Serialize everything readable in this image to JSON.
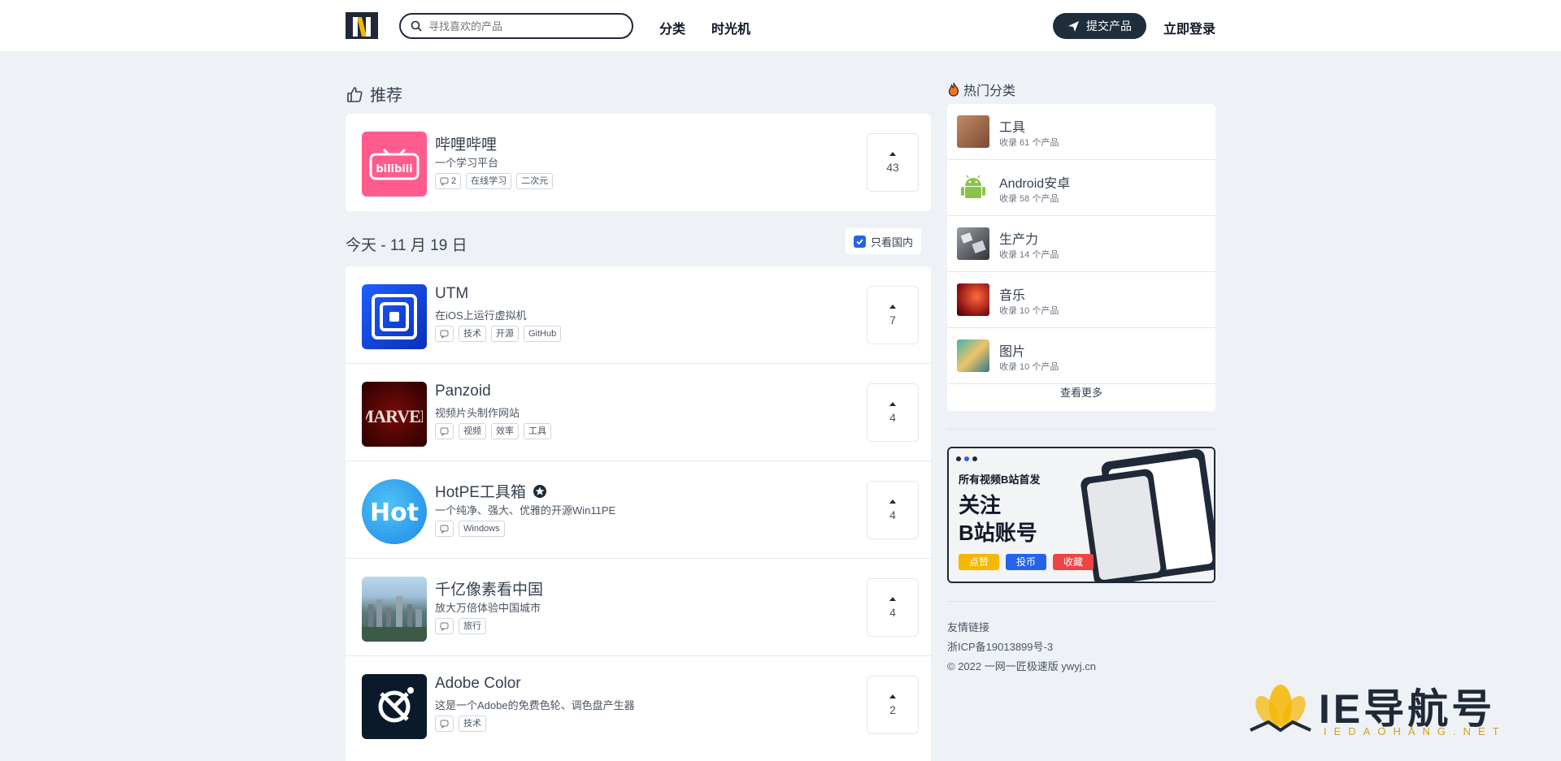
{
  "header": {
    "search_placeholder": "寻找喜欢的产品",
    "nav": [
      "分类",
      "时光机"
    ],
    "submit_label": "提交产品",
    "login_label": "立即登录"
  },
  "recommend": {
    "title": "推荐",
    "item": {
      "name": "哔哩哔哩",
      "desc": "一个学习平台",
      "comments": "2",
      "tags": [
        "在线学习",
        "二次元"
      ],
      "votes": "43",
      "icon": "bilibili-icon"
    }
  },
  "today": {
    "title": "今天 - 11 月 19 日",
    "domestic_label": "只看国内",
    "items": [
      {
        "name": "UTM",
        "desc": "在iOS上运行虚拟机",
        "tags": [
          "技术",
          "开源",
          "GitHub"
        ],
        "votes": "7",
        "icon": "utm-icon"
      },
      {
        "name": "Panzoid",
        "desc": "视频片头制作网站",
        "tags": [
          "视频",
          "效率",
          "工具"
        ],
        "votes": "4",
        "icon": "marvel-icon"
      },
      {
        "name": "HotPE工具箱",
        "desc": "一个纯净、强大、优雅的开源Win11PE",
        "tags": [
          "Windows"
        ],
        "votes": "4",
        "icon": "hot-icon"
      },
      {
        "name": "千亿像素看中国",
        "desc": "放大万倍体验中国城市",
        "tags": [
          "旅行"
        ],
        "votes": "4",
        "icon": "city-icon"
      },
      {
        "name": "Adobe Color",
        "desc": "这是一个Adobe的免费色轮、调色盘产生器",
        "tags": [
          "技术"
        ],
        "votes": "2",
        "icon": "adobe-color-icon"
      }
    ]
  },
  "sidebar": {
    "title": "热门分类",
    "categories": [
      {
        "name": "工具",
        "count": "收录 61 个产品"
      },
      {
        "name": "Android安卓",
        "count": "收录 58 个产品"
      },
      {
        "name": "生产力",
        "count": "收录 14 个产品"
      },
      {
        "name": "音乐",
        "count": "收录 10 个产品"
      },
      {
        "name": "图片",
        "count": "收录 10 个产品"
      }
    ],
    "more_label": "查看更多",
    "banner": {
      "line1": "所有视频B站首发",
      "line2": "关注",
      "line3": "B站账号",
      "btn1": "点赞",
      "btn2": "投币",
      "btn3": "收藏"
    },
    "footer": {
      "links_label": "友情链接",
      "icp": "浙ICP备19013899号-3",
      "copyright": "© 2022 一网一匠极速版 ywyj.cn"
    }
  },
  "watermark": {
    "main": "IE导航号",
    "sub": "IEDAOHANG.NET"
  },
  "colors": {
    "accent": "#1f2d3d",
    "checkbox": "#2563eb",
    "bilibili": "#ff5c8d"
  }
}
